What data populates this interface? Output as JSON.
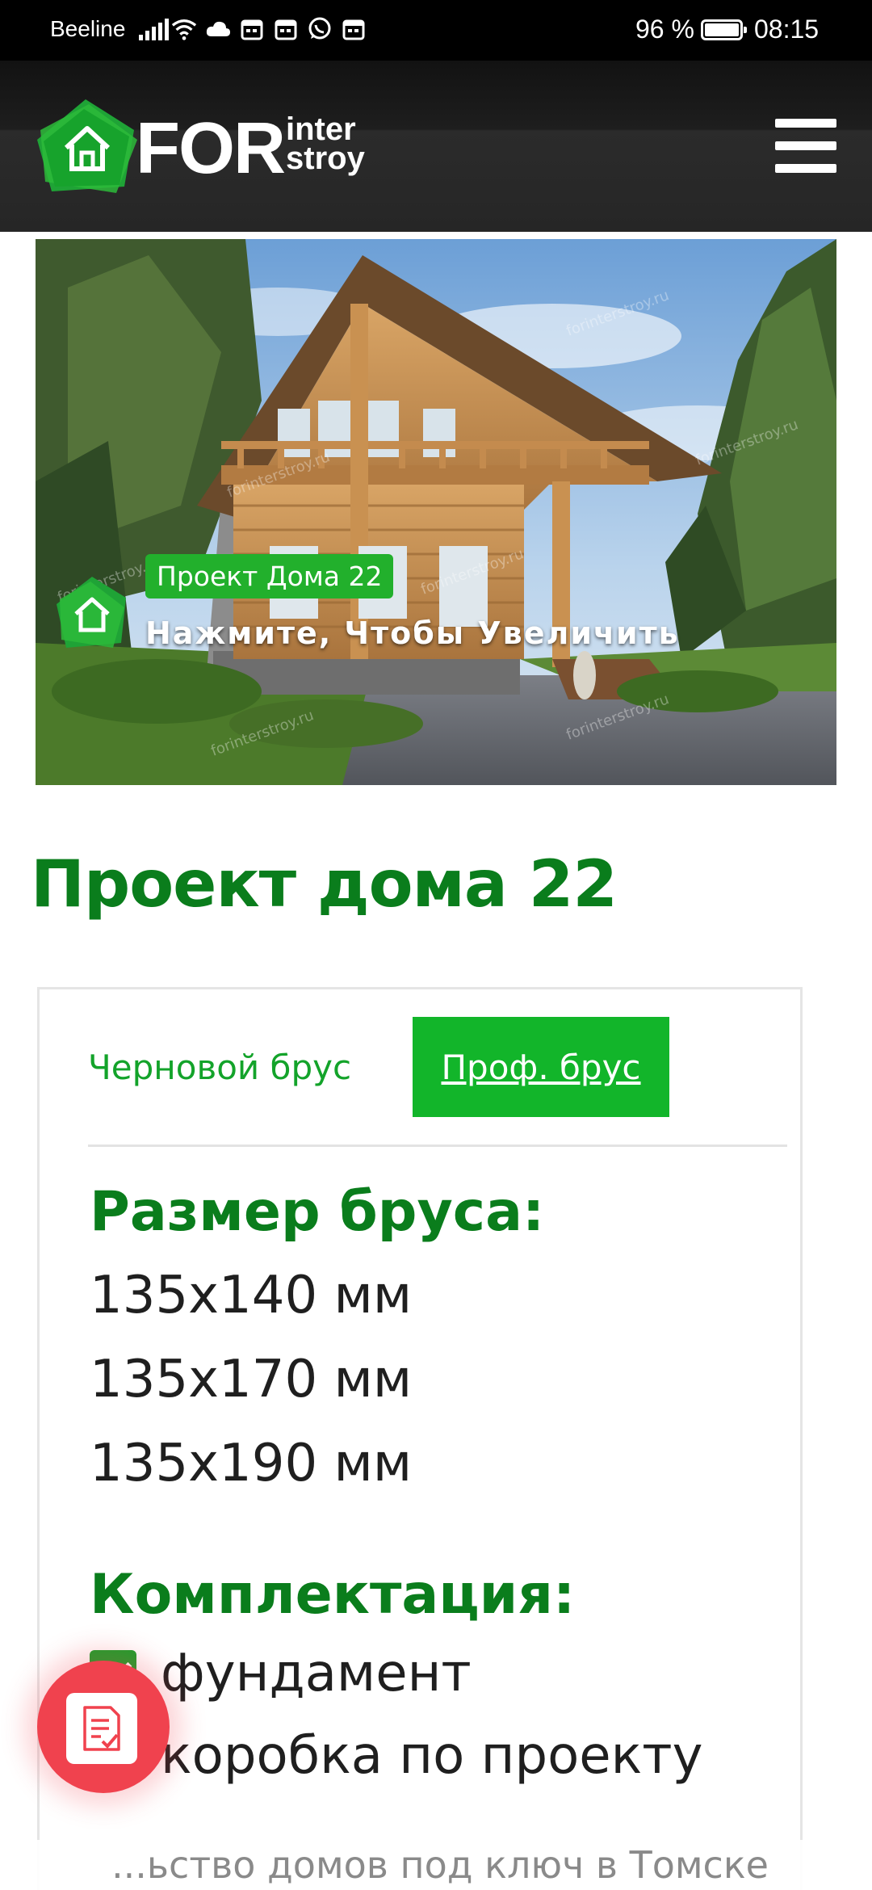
{
  "status_bar": {
    "carrier": "Beeline",
    "battery_percent": "96 %",
    "battery_level": 0.96,
    "time": "08:15",
    "icons": [
      "signal-icon",
      "wifi-icon",
      "cloud-icon",
      "calendar-icon",
      "calendar-icon",
      "whatsapp-icon",
      "calendar-icon"
    ]
  },
  "header": {
    "logo": {
      "for": "FOR",
      "inter": "inter",
      "stroy": "stroy"
    },
    "menu_icon": "hamburger-icon"
  },
  "hero": {
    "tag": "Проект Дома 22",
    "caption": "Нажмите, Чтобы Увеличить",
    "watermark": "forinterstroy.ru"
  },
  "page": {
    "title": "Проект дома 22"
  },
  "tabs": [
    {
      "label": "Черновой брус",
      "active": false
    },
    {
      "label": "Проф. брус",
      "active": true
    }
  ],
  "timber_size": {
    "title": "Размер бруса:",
    "items": [
      "135x140 мм",
      "135x170 мм",
      "135x190 мм"
    ]
  },
  "kit": {
    "title": "Комплектация:",
    "items": [
      "фундамент",
      "коробка по проекту"
    ]
  },
  "fab": {
    "icon": "document-check-icon"
  },
  "bottom_strip": {
    "text": "...ьство домов под ключ в Томске"
  },
  "colors": {
    "brand_green": "#0a7d1c",
    "tab_green": "#12b52a",
    "fab_red": "#f0424e"
  }
}
